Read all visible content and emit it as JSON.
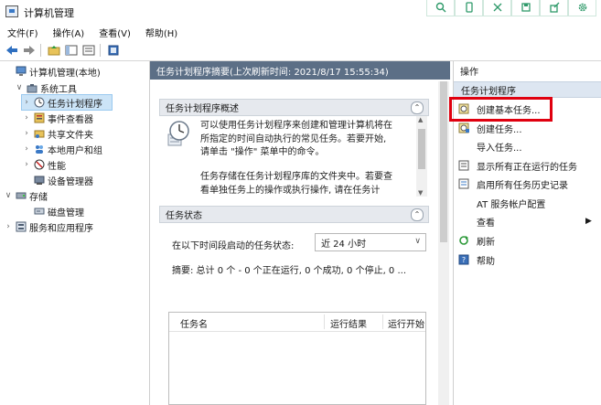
{
  "window": {
    "title": "计算机管理"
  },
  "menu": [
    "文件(F)",
    "操作(A)",
    "查看(V)",
    "帮助(H)"
  ],
  "tree": [
    {
      "label": "计算机管理(本地)",
      "expander": "",
      "icon": "computer-icon"
    },
    {
      "label": "系统工具",
      "expander": "∨",
      "icon": "tools-icon"
    },
    {
      "label": "任务计划程序",
      "expander": "›",
      "icon": "clock-icon",
      "selected": true
    },
    {
      "label": "事件查看器",
      "expander": "›",
      "icon": "event-viewer-icon"
    },
    {
      "label": "共享文件夹",
      "expander": "›",
      "icon": "shared-folder-icon"
    },
    {
      "label": "本地用户和组",
      "expander": "›",
      "icon": "users-icon"
    },
    {
      "label": "性能",
      "expander": "›",
      "icon": "performance-icon"
    },
    {
      "label": "设备管理器",
      "expander": "",
      "icon": "device-manager-icon"
    },
    {
      "label": "存储",
      "expander": "∨",
      "icon": "storage-icon"
    },
    {
      "label": "磁盘管理",
      "expander": "",
      "icon": "disk-icon"
    },
    {
      "label": "服务和应用程序",
      "expander": "›",
      "icon": "services-icon"
    }
  ],
  "main": {
    "header": "任务计划程序摘要(上次刷新时间: 2021/8/17 15:55:34)",
    "overview": {
      "title": "任务计划程序概述",
      "para1": [
        "可以使用任务计划程序来创建和管理计算机将在",
        "所指定的时间自动执行的常见任务。若要开始,",
        "请单击 \"操作\" 菜单中的命令。"
      ],
      "para2": [
        "任务存储在任务计划程序库的文件夹中。若要查",
        "看单独任务上的操作或执行操作, 请在任务计"
      ]
    },
    "status": {
      "title": "任务状态",
      "filter_label": "在以下时间段启动的任务状态:",
      "filter_value": "近 24 小时",
      "summary": "摘要: 总计 0 个 - 0 个正在运行, 0 个成功, 0 个停止, 0 ...",
      "columns": [
        "任务名",
        "运行结果",
        "运行开始"
      ]
    }
  },
  "actions": {
    "header": "操作",
    "subheader": "任务计划程序",
    "items": [
      {
        "label": "创建基本任务...",
        "icon": "create-basic-task-icon",
        "highlight": true
      },
      {
        "label": "创建任务...",
        "icon": "create-task-icon"
      },
      {
        "label": "导入任务...",
        "icon": ""
      },
      {
        "label": "显示所有正在运行的任务",
        "icon": "running-tasks-icon"
      },
      {
        "label": "启用所有任务历史记录",
        "icon": "history-icon"
      },
      {
        "label": "AT 服务帐户配置",
        "icon": ""
      },
      {
        "label": "查看",
        "icon": "",
        "submenu": true
      },
      {
        "label": "刷新",
        "icon": "refresh-icon"
      },
      {
        "label": "帮助",
        "icon": "help-icon"
      }
    ]
  },
  "colors": {
    "highlight_box": "#e0000f",
    "header_blue": "#5c6f86",
    "selection": "#cce4f7"
  }
}
